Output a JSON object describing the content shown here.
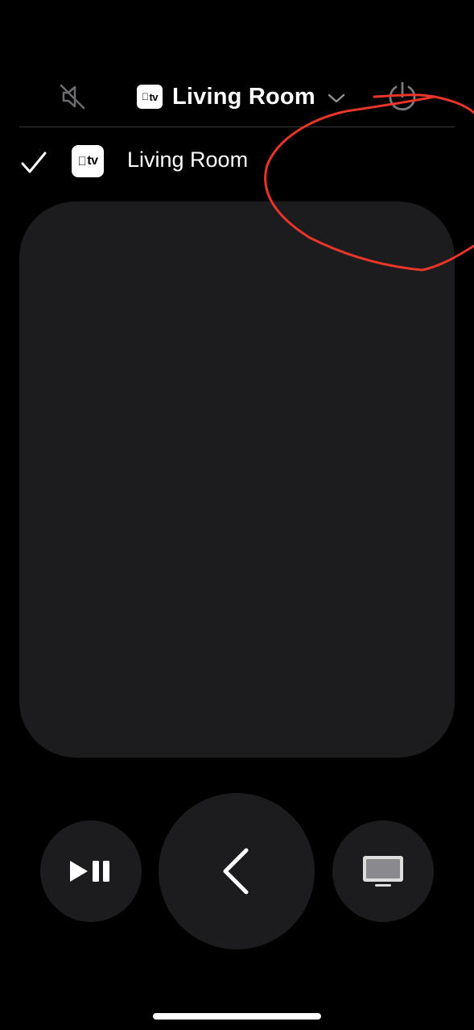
{
  "header": {
    "device_title": "Living Room",
    "badge_text": "tv",
    "mute_icon": "speaker-muted-icon",
    "power_icon": "power-icon"
  },
  "device_list": {
    "items": [
      {
        "label": "Living Room",
        "badge_text": "tv",
        "selected": true
      }
    ]
  },
  "controls": {
    "play_pause_icon": "play-pause-icon",
    "back_icon": "chevron-left-icon",
    "tv_icon": "tv-icon"
  },
  "colors": {
    "background": "#000000",
    "surface": "#1c1c1e",
    "annotation": "#e8352a",
    "dim_icon": "#8e8e93"
  }
}
